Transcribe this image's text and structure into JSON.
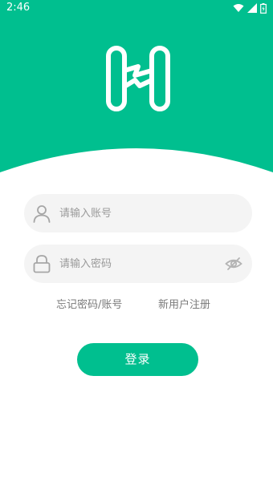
{
  "status_bar": {
    "time": "2:46",
    "icons": [
      "wifi-icon",
      "signal-icon",
      "battery-icon"
    ]
  },
  "header": {
    "logo": "h-logo-icon",
    "background_color": "#00bf8f"
  },
  "form": {
    "username": {
      "placeholder": "请输入账号",
      "icon": "user-icon",
      "value": ""
    },
    "password": {
      "placeholder": "请输入密码",
      "icon": "lock-icon",
      "toggle_icon": "eye-hidden-icon",
      "value": ""
    }
  },
  "links": {
    "forgot": "忘记密码/账号",
    "register": "新用户注册"
  },
  "login_button": {
    "label": "登录",
    "color": "#00bf8f"
  }
}
